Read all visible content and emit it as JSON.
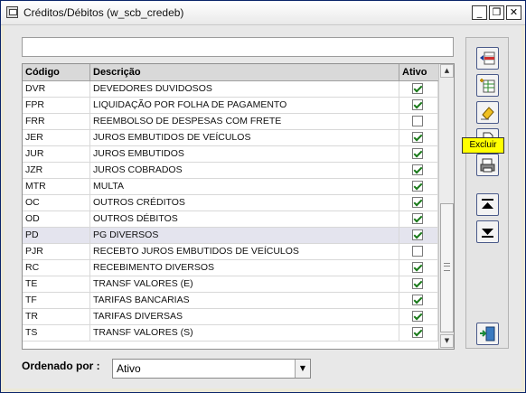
{
  "window": {
    "title": "Créditos/Débitos (w_scb_credeb)",
    "minimize_glyph": "_",
    "restore_glyph": "❐",
    "close_glyph": "✕"
  },
  "filter": {
    "value": ""
  },
  "grid": {
    "headers": {
      "code": "Código",
      "desc": "Descrição",
      "active": "Ativo"
    },
    "selected_row_index": 9,
    "rows": [
      {
        "code": "DVR",
        "desc": "DEVEDORES DUVIDOSOS",
        "active": true
      },
      {
        "code": "FPR",
        "desc": "LIQUIDAÇÃO POR FOLHA DE PAGAMENTO",
        "active": true
      },
      {
        "code": "FRR",
        "desc": "REEMBOLSO DE DESPESAS COM FRETE",
        "active": false
      },
      {
        "code": "JER",
        "desc": "JUROS EMBUTIDOS DE VEÍCULOS",
        "active": true
      },
      {
        "code": "JUR",
        "desc": "JUROS EMBUTIDOS",
        "active": true
      },
      {
        "code": "JZR",
        "desc": "JUROS COBRADOS",
        "active": true
      },
      {
        "code": "MTR",
        "desc": "MULTA",
        "active": true
      },
      {
        "code": "OC",
        "desc": "OUTROS CRÉDITOS",
        "active": true
      },
      {
        "code": "OD",
        "desc": "OUTROS DÉBITOS",
        "active": true
      },
      {
        "code": "PD",
        "desc": "PG DIVERSOS",
        "active": true
      },
      {
        "code": "PJR",
        "desc": "RECEBTO JUROS EMBUTIDOS DE VEÍCULOS",
        "active": false
      },
      {
        "code": "RC",
        "desc": "RECEBIMENTO DIVERSOS",
        "active": true
      },
      {
        "code": "TE",
        "desc": "TRANSF VALORES (E)",
        "active": true
      },
      {
        "code": "TF",
        "desc": "TARIFAS BANCARIAS",
        "active": true
      },
      {
        "code": "TR",
        "desc": "TARIFAS DIVERSAS",
        "active": true
      },
      {
        "code": "TS",
        "desc": "TRANSF VALORES (S)",
        "active": true
      }
    ]
  },
  "scrollbar": {
    "up_glyph": "▲",
    "down_glyph": "▼"
  },
  "toolbar": {
    "icons": [
      "insert-row-icon",
      "add-record-icon",
      "delete-eraser-icon",
      "document-icon",
      "print-icon",
      "move-top-icon",
      "move-down-icon",
      "exit-door-icon"
    ],
    "tooltip": "Excluir"
  },
  "order": {
    "label": "Ordenado por :",
    "selected": "Ativo",
    "dropdown_glyph": "▼"
  }
}
